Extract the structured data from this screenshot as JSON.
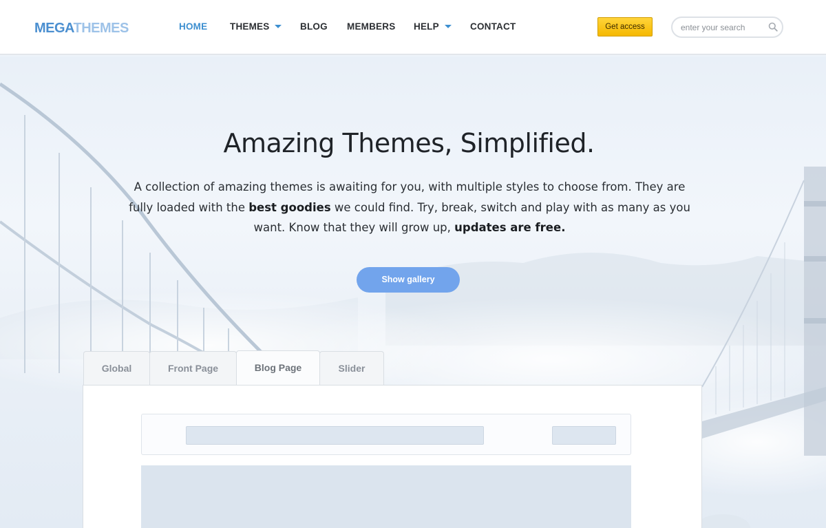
{
  "header": {
    "logo": {
      "part1": "MEGA",
      "part2": "THEMES"
    },
    "nav": [
      {
        "label": "HOME",
        "active": true,
        "dropdown": false
      },
      {
        "label": "THEMES",
        "active": false,
        "dropdown": true
      },
      {
        "label": "BLOG",
        "active": false,
        "dropdown": false
      },
      {
        "label": "MEMBERS",
        "active": false,
        "dropdown": false
      },
      {
        "label": "HELP",
        "active": false,
        "dropdown": true
      },
      {
        "label": "CONTACT",
        "active": false,
        "dropdown": false
      }
    ],
    "cta_label": "Get access",
    "search": {
      "placeholder": "enter your search",
      "value": ""
    }
  },
  "hero": {
    "title": "Amazing Themes, Simplified.",
    "text": {
      "p1": "A collection of amazing themes is awaiting for you, with multiple styles to choose from. They are fully loaded with the ",
      "b1": "best goodies",
      "p2": " we could find. Try, break, switch and play with as many as you want. Know that they will grow up, ",
      "b2": "updates are free."
    },
    "button_label": "Show gallery"
  },
  "tabs": [
    {
      "label": "Global",
      "active": false
    },
    {
      "label": "Front Page",
      "active": false
    },
    {
      "label": "Blog Page",
      "active": true
    },
    {
      "label": "Slider",
      "active": false
    }
  ],
  "colors": {
    "accent": "#3d8fd0",
    "cta": "#f5b800",
    "gallery_button": "#72a4ec"
  },
  "icons": {
    "search": "search-icon",
    "dropdown": "chevron-down-icon"
  }
}
